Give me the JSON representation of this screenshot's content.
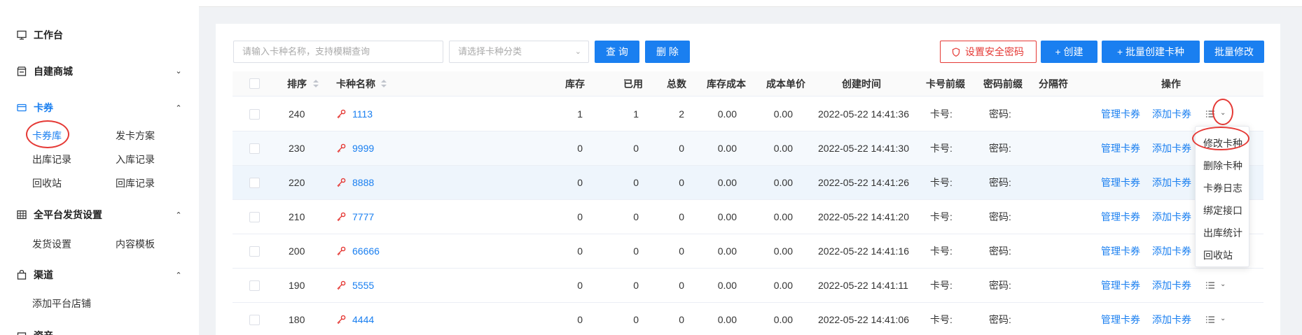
{
  "sidebar": {
    "workbench": "工作台",
    "mall": "自建商城",
    "cards": "卡券",
    "card_items": [
      "卡券库",
      "发卡方案",
      "出库记录",
      "入库记录",
      "回收站",
      "回库记录"
    ],
    "delivery": "全平台发货设置",
    "delivery_items": [
      "发货设置",
      "内容模板"
    ],
    "channel": "渠道",
    "channel_items": [
      "添加平台店铺"
    ],
    "assets": "资产"
  },
  "toolbar": {
    "search_placeholder": "请输入卡种名称，支持模糊查询",
    "category_placeholder": "请选择卡种分类",
    "query": "查 询",
    "delete": "删 除",
    "security": "设置安全密码",
    "create": "+ 创建",
    "batch_create": "+ 批量创建卡种",
    "batch_edit": "批量修改"
  },
  "table": {
    "headers": [
      "排序",
      "卡种名称",
      "库存",
      "已用",
      "总数",
      "库存成本",
      "成本单价",
      "创建时间",
      "卡号前缀",
      "密码前缀",
      "分隔符",
      "操作"
    ],
    "rows": [
      {
        "sort": "240",
        "name": "1113",
        "stock": "1",
        "used": "1",
        "total": "2",
        "cost": "0.00",
        "unit": "0.00",
        "time": "2022-05-22 14:41:36",
        "card_prefix": "卡号:",
        "pwd_prefix": "密码:"
      },
      {
        "sort": "230",
        "name": "9999",
        "stock": "0",
        "used": "0",
        "total": "0",
        "cost": "0.00",
        "unit": "0.00",
        "time": "2022-05-22 14:41:30",
        "card_prefix": "卡号:",
        "pwd_prefix": "密码:"
      },
      {
        "sort": "220",
        "name": "8888",
        "stock": "0",
        "used": "0",
        "total": "0",
        "cost": "0.00",
        "unit": "0.00",
        "time": "2022-05-22 14:41:26",
        "card_prefix": "卡号:",
        "pwd_prefix": "密码:"
      },
      {
        "sort": "210",
        "name": "7777",
        "stock": "0",
        "used": "0",
        "total": "0",
        "cost": "0.00",
        "unit": "0.00",
        "time": "2022-05-22 14:41:20",
        "card_prefix": "卡号:",
        "pwd_prefix": "密码:"
      },
      {
        "sort": "200",
        "name": "66666",
        "stock": "0",
        "used": "0",
        "total": "0",
        "cost": "0.00",
        "unit": "0.00",
        "time": "2022-05-22 14:41:16",
        "card_prefix": "卡号:",
        "pwd_prefix": "密码:"
      },
      {
        "sort": "190",
        "name": "5555",
        "stock": "0",
        "used": "0",
        "total": "0",
        "cost": "0.00",
        "unit": "0.00",
        "time": "2022-05-22 14:41:11",
        "card_prefix": "卡号:",
        "pwd_prefix": "密码:"
      },
      {
        "sort": "180",
        "name": "4444",
        "stock": "0",
        "used": "0",
        "total": "0",
        "cost": "0.00",
        "unit": "0.00",
        "time": "2022-05-22 14:41:06",
        "card_prefix": "卡号:",
        "pwd_prefix": "密码:"
      }
    ],
    "manage": "管理卡券",
    "add": "添加卡券"
  },
  "dropdown": [
    "修改卡种",
    "删除卡种",
    "卡券日志",
    "绑定接口",
    "出库统计",
    "回收站"
  ],
  "colors": {
    "accent": "#1a7ff0",
    "annotation": "#e53935"
  }
}
